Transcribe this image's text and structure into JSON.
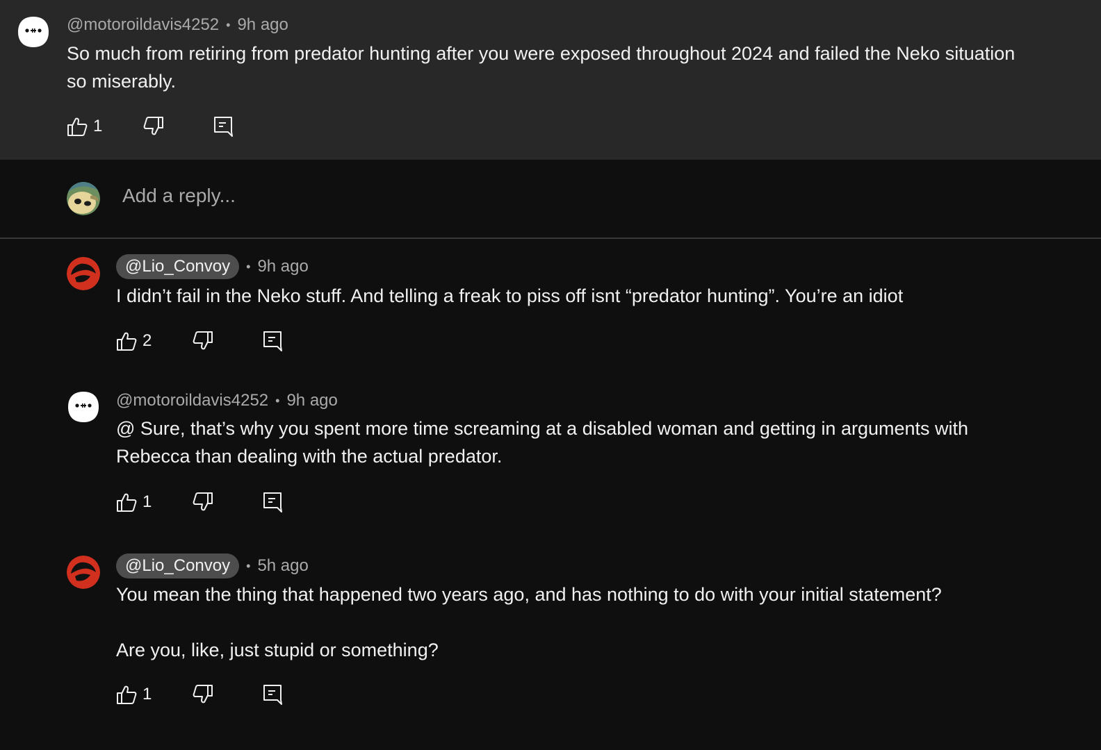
{
  "parent_comment": {
    "handle": "@motoroildavis4252",
    "time": "9h ago",
    "text_line1": "So much from retiring from predator hunting after you were exposed throughout 2024 and failed the Neko situation",
    "text_line2": "so miserably.",
    "likes": "1",
    "avatar_icon": "blob-face-avatar"
  },
  "composer": {
    "placeholder": "Add a reply...",
    "avatar_icon": "user-avatar"
  },
  "replies": [
    {
      "handle": "@Lio_Convoy",
      "time": "9h ago",
      "text_line1": "I didn’t fail in the Neko stuff. And telling a freak to piss off isnt “predator hunting”. You’re an idiot",
      "likes": "2",
      "avatar_icon": "thundercats-logo-avatar"
    },
    {
      "handle": "@motoroildavis4252",
      "time": "9h ago",
      "text_line1": "@ Sure, that’s why you spent more time screaming at a disabled woman and getting in arguments with",
      "text_line2": "Rebecca than dealing with the actual predator.",
      "likes": "1",
      "avatar_icon": "blob-face-avatar"
    },
    {
      "handle": "@Lio_Convoy",
      "time": "5h ago",
      "text_line1": "You mean the thing that happened two years ago, and has nothing to do with your initial statement?",
      "text_line2": "Are you, like, just stupid or something?",
      "likes": "1",
      "avatar_icon": "thundercats-logo-avatar"
    }
  ],
  "colors": {
    "parent_bg": "#282828",
    "page_bg": "#0f0f0f",
    "meta_text": "#aaaaaa",
    "handle_pill_bg": "#4d4d4d",
    "avatar_red": "#d1301f"
  }
}
